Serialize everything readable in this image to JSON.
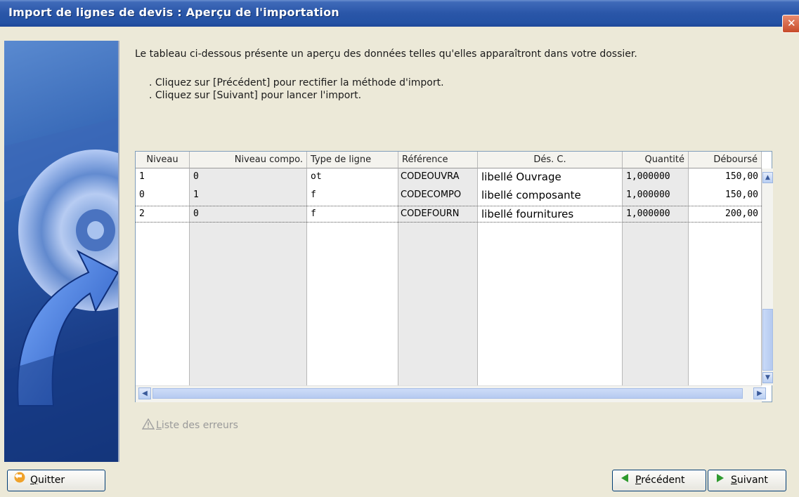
{
  "window": {
    "title": "Import de lignes de devis : Aperçu de l'importation"
  },
  "intro": {
    "text": "Le tableau ci-dessous présente un aperçu des données telles qu'elles apparaîtront dans votre dossier.",
    "bullets": [
      ". Cliquez sur [Précédent] pour rectifier la méthode d'import.",
      ". Cliquez sur [Suivant] pour lancer l'import."
    ]
  },
  "table": {
    "headers": [
      "Niveau",
      "Niveau compo.",
      "Type de ligne",
      "Référence",
      "Dés. C.",
      "Quantité",
      "Déboursé"
    ],
    "rows": [
      [
        "1",
        "0",
        "ot",
        "CODEOUVRA",
        "libellé Ouvrage",
        "1,000000",
        "150,00"
      ],
      [
        "0",
        "1",
        "f",
        "CODECOMPO",
        "libellé composante",
        "1,000000",
        "150,00"
      ],
      [
        "2",
        "0",
        "f",
        "CODEFOURN",
        "libellé fournitures",
        "1,000000",
        "200,00"
      ]
    ]
  },
  "errors_link": {
    "prefix": "L",
    "rest": "iste des erreurs"
  },
  "buttons": {
    "quit": {
      "u": "Q",
      "rest": "uitter"
    },
    "prev": {
      "u": "P",
      "rest": "récédent"
    },
    "next": {
      "u": "S",
      "rest": "uivant"
    }
  },
  "icons": {
    "close": "close-icon",
    "warning": "warning-icon",
    "quit": "quit-arrow-icon",
    "prev": "left-triangle-icon",
    "next": "right-triangle-icon"
  },
  "colors": {
    "titlebar": "#2452a4",
    "dialog_bg": "#ece9d8",
    "grey_column": "#eaeaea",
    "next_icon": "#2e9a2e",
    "quit_icon": "#e08a1a"
  }
}
